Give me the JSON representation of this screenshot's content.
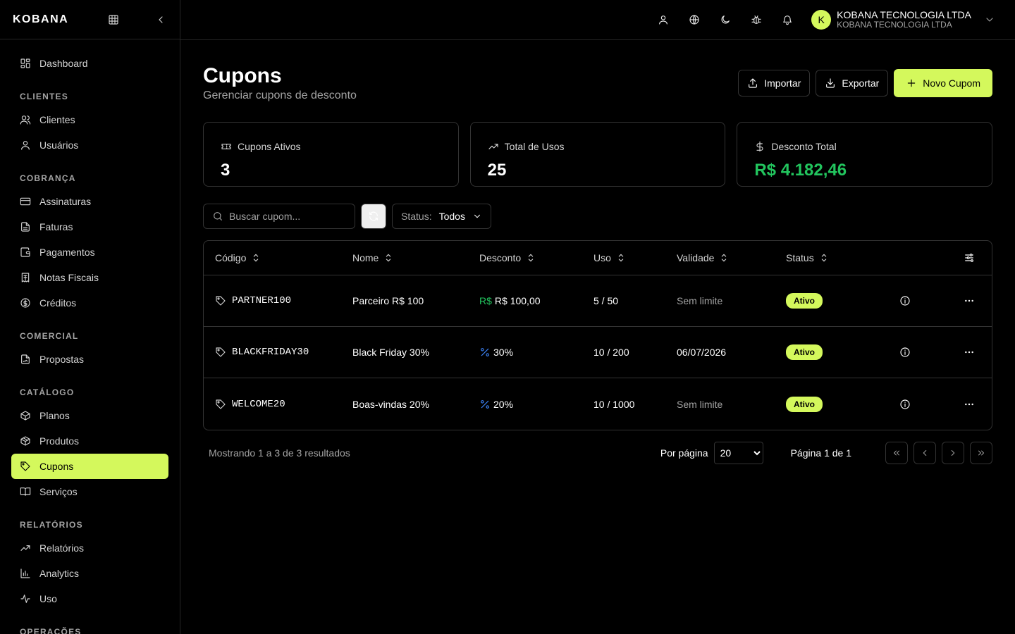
{
  "brand": {
    "logo": "KOBANA",
    "accent": "#d4f85c"
  },
  "sidebar": {
    "top_items": [
      {
        "label": "Dashboard",
        "icon": "dashboard-icon"
      }
    ],
    "sections": [
      {
        "title": "CLIENTES",
        "items": [
          {
            "label": "Clientes",
            "icon": "users-icon"
          },
          {
            "label": "Usuários",
            "icon": "user-icon"
          }
        ]
      },
      {
        "title": "COBRANÇA",
        "items": [
          {
            "label": "Assinaturas",
            "icon": "card-icon"
          },
          {
            "label": "Faturas",
            "icon": "file-icon"
          },
          {
            "label": "Pagamentos",
            "icon": "wallet-icon"
          },
          {
            "label": "Notas Fiscais",
            "icon": "receipt-icon"
          },
          {
            "label": "Créditos",
            "icon": "coin-icon"
          }
        ]
      },
      {
        "title": "COMERCIAL",
        "items": [
          {
            "label": "Propostas",
            "icon": "file-sign-icon"
          }
        ]
      },
      {
        "title": "CATÁLOGO",
        "items": [
          {
            "label": "Planos",
            "icon": "box-icon"
          },
          {
            "label": "Produtos",
            "icon": "package-icon"
          },
          {
            "label": "Cupons",
            "icon": "tag-icon",
            "active": true
          },
          {
            "label": "Serviços",
            "icon": "book-icon"
          }
        ]
      },
      {
        "title": "RELATÓRIOS",
        "items": [
          {
            "label": "Relatórios",
            "icon": "trend-icon"
          },
          {
            "label": "Analytics",
            "icon": "bar-chart-icon"
          },
          {
            "label": "Uso",
            "icon": "activity-icon"
          }
        ]
      },
      {
        "title": "OPERAÇÕES",
        "items": []
      }
    ]
  },
  "topbar": {
    "account_name": "KOBANA TECNOLOGIA LTDA",
    "account_sub": "KOBANA TECNOLOGIA LTDA",
    "avatar_initial": "K"
  },
  "page": {
    "title": "Cupons",
    "subtitle": "Gerenciar cupons de desconto",
    "import_label": "Importar",
    "export_label": "Exportar",
    "new_label": "Novo Cupom"
  },
  "stats": [
    {
      "label": "Cupons Ativos",
      "value": "3",
      "icon": "ticket-icon"
    },
    {
      "label": "Total de Usos",
      "value": "25",
      "icon": "trend-icon"
    },
    {
      "label": "Desconto Total",
      "value": "R$ 4.182,46",
      "icon": "dollar-icon",
      "green": true
    }
  ],
  "filters": {
    "search_placeholder": "Buscar cupom...",
    "status_label": "Status:",
    "status_value": "Todos"
  },
  "table": {
    "headers": [
      "Código",
      "Nome",
      "Desconto",
      "Uso",
      "Validade",
      "Status"
    ],
    "rows": [
      {
        "code": "PARTNER100",
        "name": "Parceiro R$ 100",
        "discount_type": "fixed",
        "discount_prefix": "R$",
        "discount": "R$ 100,00",
        "usage": "5 / 50",
        "validity": "Sem limite",
        "validity_muted": true,
        "status": "Ativo"
      },
      {
        "code": "BLACKFRIDAY30",
        "name": "Black Friday 30%",
        "discount_type": "percent",
        "discount_prefix": "%",
        "discount": "30%",
        "usage": "10 / 200",
        "validity": "06/07/2026",
        "validity_muted": false,
        "status": "Ativo"
      },
      {
        "code": "WELCOME20",
        "name": "Boas-vindas 20%",
        "discount_type": "percent",
        "discount_prefix": "%",
        "discount": "20%",
        "usage": "10 / 1000",
        "validity": "Sem limite",
        "validity_muted": true,
        "status": "Ativo"
      }
    ]
  },
  "pagination": {
    "showing": "Mostrando 1 a 3 de 3 resultados",
    "per_page_label": "Por página",
    "per_page_value": "20",
    "page_info": "Página 1 de 1"
  }
}
